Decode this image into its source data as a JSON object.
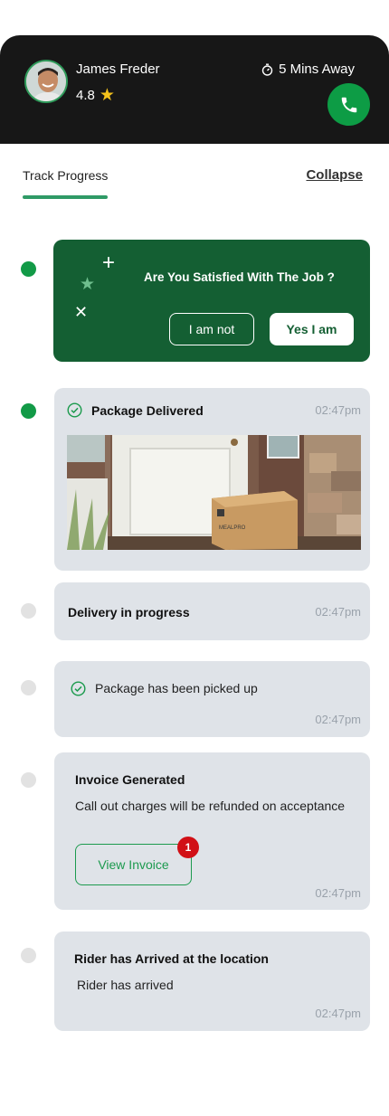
{
  "driver": {
    "name": "James Freder",
    "rating": "4.8",
    "eta": "5 Mins Away"
  },
  "tabs": {
    "track": "Track Progress",
    "collapse": "Collapse"
  },
  "satisfaction": {
    "question": "Are You Satisfied With The Job ?",
    "no_label": "I am not",
    "yes_label": "Yes I am"
  },
  "timeline": {
    "delivered": {
      "title": "Package Delivered",
      "time": "02:47pm",
      "box_brand": "MEALPRO"
    },
    "in_progress": {
      "title": "Delivery in progress",
      "time": "02:47pm"
    },
    "picked_up": {
      "title": "Package has been picked up",
      "time": "02:47pm"
    },
    "invoice": {
      "title": "Invoice Generated",
      "text": "Call out charges will be refunded on acceptance",
      "button": "View Invoice",
      "badge": "1",
      "time": "02:47pm"
    },
    "arrived": {
      "title": "Rider has Arrived at the location",
      "text": "Rider has arrived",
      "time": "02:47pm"
    }
  },
  "colors": {
    "header_bg": "#171717",
    "accent_green": "#129a47",
    "card_green": "#145f33",
    "card_grey": "#dfe3e8",
    "badge_red": "#d11016",
    "star_yellow": "#f4c21b"
  }
}
